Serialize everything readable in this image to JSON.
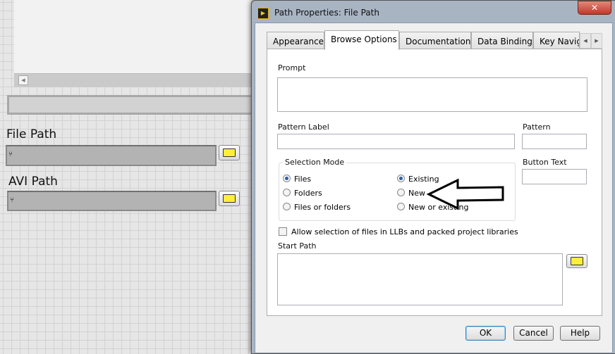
{
  "front_panel": {
    "file_path": {
      "label": "File Path",
      "value": ""
    },
    "avi_path": {
      "label": "AVI Path",
      "value": ""
    }
  },
  "dialog": {
    "title": "Path Properties: File Path",
    "close_label": "✕",
    "tabs": [
      {
        "label": "Appearance"
      },
      {
        "label": "Browse Options",
        "active": true
      },
      {
        "label": "Documentation"
      },
      {
        "label": "Data Binding"
      },
      {
        "label": "Key Navig"
      }
    ],
    "prompt": {
      "label": "Prompt",
      "value": ""
    },
    "pattern_label": {
      "label": "Pattern Label",
      "value": ""
    },
    "pattern": {
      "label": "Pattern",
      "value": ""
    },
    "button_text": {
      "label": "Button Text",
      "value": ""
    },
    "selection_mode": {
      "label": "Selection Mode",
      "type_options": [
        {
          "label": "Files",
          "selected": true
        },
        {
          "label": "Folders",
          "selected": false
        },
        {
          "label": "Files or folders",
          "selected": false
        }
      ],
      "existence_options": [
        {
          "label": "Existing",
          "selected": true
        },
        {
          "label": "New",
          "selected": false
        },
        {
          "label": "New or existing",
          "selected": false
        }
      ]
    },
    "allow_llb": {
      "label": "Allow selection of files in LLBs and packed project libraries",
      "checked": false
    },
    "start_path": {
      "label": "Start Path",
      "value": ""
    },
    "buttons": {
      "ok": "OK",
      "cancel": "Cancel",
      "help": "Help"
    }
  }
}
